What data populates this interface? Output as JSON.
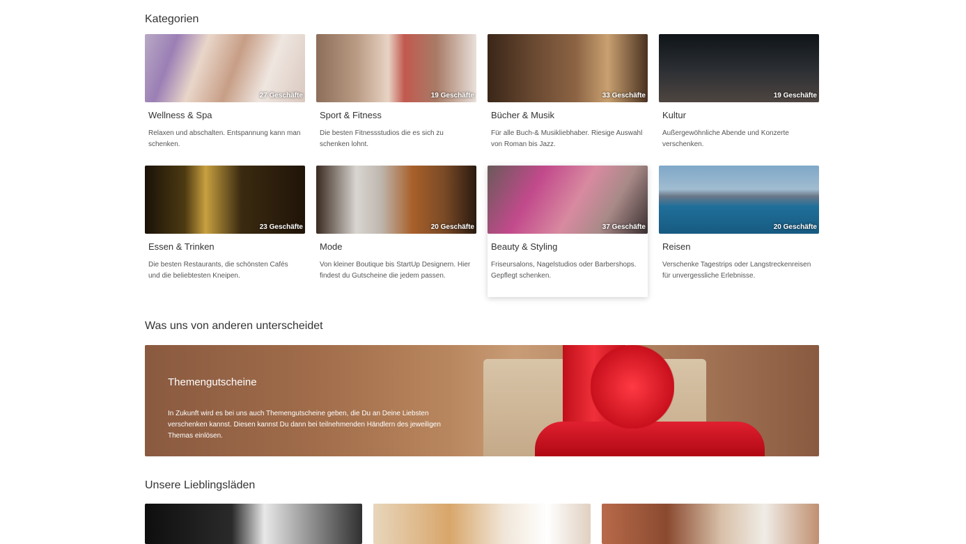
{
  "sections": {
    "categories_title": "Kategorien",
    "difference_title": "Was uns von anderen unterscheidet",
    "favorites_title": "Unsere Lieblingsläden"
  },
  "categories": [
    {
      "name": "Wellness & Spa",
      "count": "27 Geschäfte",
      "desc": "Relaxen und abschalten. Entspannung kann man schenken."
    },
    {
      "name": "Sport & Fitness",
      "count": "19 Geschäfte",
      "desc": "Die besten Fitnessstudios die es sich zu schenken lohnt."
    },
    {
      "name": "Bücher & Musik",
      "count": "33 Geschäfte",
      "desc": "Für alle Buch-& Musikliebhaber. Riesige Auswahl von Roman bis Jazz."
    },
    {
      "name": "Kultur",
      "count": "19 Geschäfte",
      "desc": "Außergewöhnliche Abende und Konzerte verschenken."
    },
    {
      "name": "Essen & Trinken",
      "count": "23 Geschäfte",
      "desc": "Die besten Restaurants, die schönsten Cafés und die beliebtesten Kneipen."
    },
    {
      "name": "Mode",
      "count": "20 Geschäfte",
      "desc": "Von kleiner Boutique bis StartUp Designern. Hier findest du Gutscheine die jedem passen."
    },
    {
      "name": "Beauty & Styling",
      "count": "37 Geschäfte",
      "desc": "Friseursalons, Nagelstudios oder Barbershops. Gepflegt schenken."
    },
    {
      "name": "Reisen",
      "count": "20 Geschäfte",
      "desc": "Verschenke Tagestrips oder Langstreckenreisen für unvergessliche Erlebnisse."
    }
  ],
  "banner": {
    "title": "Themengutscheine",
    "text": "In Zukunft wird es bei uns auch Themengutscheine geben, die Du an Deine Liebsten verschenken kannst. Diesen kannst Du dann bei teilnehmenden Händlern des jeweiligen Themas einlösen."
  }
}
